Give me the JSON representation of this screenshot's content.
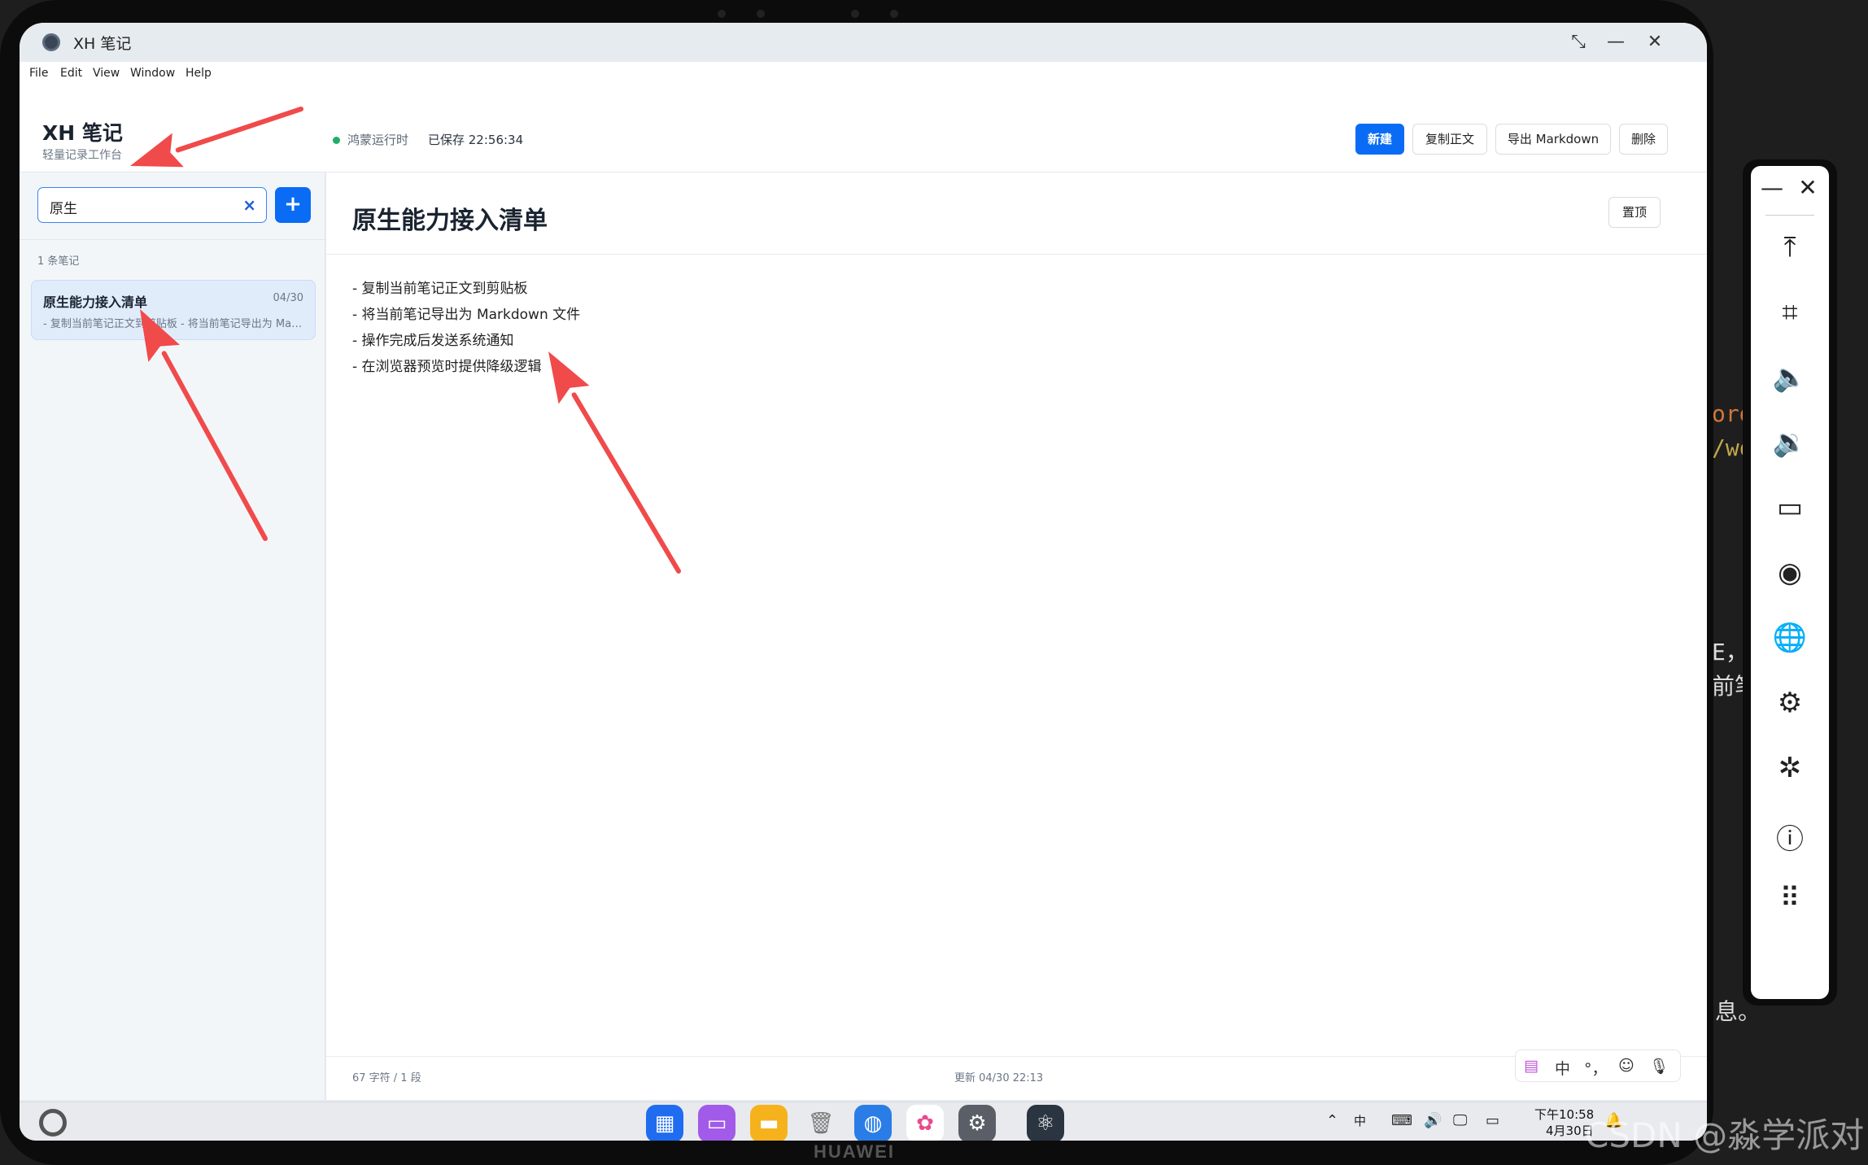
{
  "window": {
    "title": "XH 笔记",
    "controls": [
      "minimize-icon",
      "maximize-icon",
      "close-icon"
    ]
  },
  "menu": [
    "File",
    "Edit",
    "View",
    "Window",
    "Help"
  ],
  "header": {
    "app_name": "XH 笔记",
    "app_subtitle": "轻量记录工作台",
    "status": "鸿蒙运行时",
    "saved": "已保存 22:56:34",
    "buttons": {
      "new": "新建",
      "copy": "复制正文",
      "export": "导出 Markdown",
      "delete": "删除"
    }
  },
  "sidebar": {
    "search_value": "原生",
    "clear_glyph": "×",
    "add_glyph": "+",
    "count": "1 条笔记",
    "notes": [
      {
        "title": "原生能力接入清单",
        "date": "04/30",
        "preview": "- 复制当前笔记正文到剪贴板 - 将当前笔记导出为 Markdown 文件"
      }
    ]
  },
  "editor": {
    "title": "原生能力接入清单",
    "pin": "置顶",
    "lines": [
      "- 复制当前笔记正文到剪贴板",
      "- 将当前笔记导出为 Markdown 文件",
      "- 操作完成后发送系统通知",
      "- 在浏览器预览时提供降级逻辑"
    ],
    "char_count": "67 字符 / 1 段",
    "updated": "更新 04/30 22:13"
  },
  "ime": {
    "lang": "中",
    "punct": "°，"
  },
  "taskbar": {
    "time": "下午10:58",
    "date": "4月30日"
  },
  "brand": "HUAWEI",
  "watermark": "CSDN @淼学派对",
  "colors": {
    "accent": "#0a6cf5",
    "status_dot": "#1fae6a",
    "annotation_arrow": "#f04a4a"
  }
}
